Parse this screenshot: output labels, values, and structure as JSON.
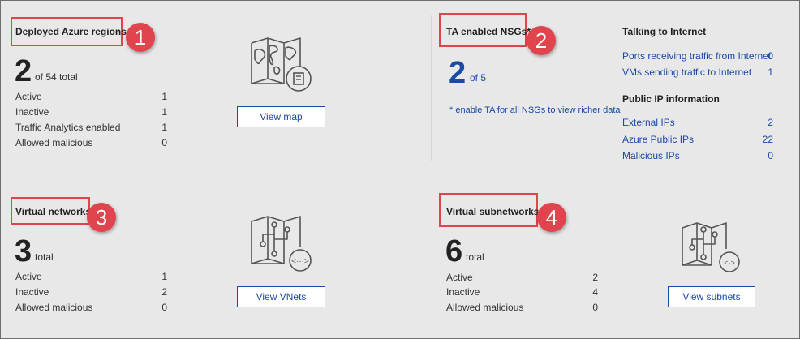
{
  "regions": {
    "title": "Deployed Azure regions",
    "badge": "1",
    "count": "2",
    "suffix": "of 54 total",
    "rows": [
      {
        "label": "Active",
        "value": "1"
      },
      {
        "label": "Inactive",
        "value": "1"
      },
      {
        "label": "Traffic Analytics enabled",
        "value": "1"
      },
      {
        "label": "Allowed malicious",
        "value": "0"
      }
    ],
    "button": "View map",
    "icon": "world-map-icon"
  },
  "nsgs": {
    "title": "TA enabled NSGs*",
    "badge": "2",
    "count": "2",
    "suffix": "of 5",
    "note": "* enable TA for all NSGs to view richer data",
    "talking": {
      "heading": "Talking to Internet",
      "rows": [
        {
          "label": "Ports receiving traffic from Internet",
          "value": "0"
        },
        {
          "label": "VMs sending traffic to Internet",
          "value": "1"
        }
      ]
    },
    "public_ip": {
      "heading": "Public IP information",
      "rows": [
        {
          "label": "External IPs",
          "value": "2"
        },
        {
          "label": "Azure Public IPs",
          "value": "22"
        },
        {
          "label": "Malicious IPs",
          "value": "0"
        }
      ]
    }
  },
  "vnets": {
    "title": "Virtual networks",
    "badge": "3",
    "count": "3",
    "suffix": "total",
    "rows": [
      {
        "label": "Active",
        "value": "1"
      },
      {
        "label": "Inactive",
        "value": "2"
      },
      {
        "label": "Allowed malicious",
        "value": "0"
      }
    ],
    "button": "View VNets",
    "icon": "network-map-icon"
  },
  "subnets": {
    "title": "Virtual subnetworks",
    "badge": "4",
    "count": "6",
    "suffix": "total",
    "rows": [
      {
        "label": "Active",
        "value": "2"
      },
      {
        "label": "Inactive",
        "value": "4"
      },
      {
        "label": "Allowed malicious",
        "value": "0"
      }
    ],
    "button": "View subnets",
    "icon": "subnet-map-icon"
  },
  "colors": {
    "background": "#e8e8e8",
    "accent_blue": "#1a49a6",
    "annotation_red": "#e0454e"
  }
}
